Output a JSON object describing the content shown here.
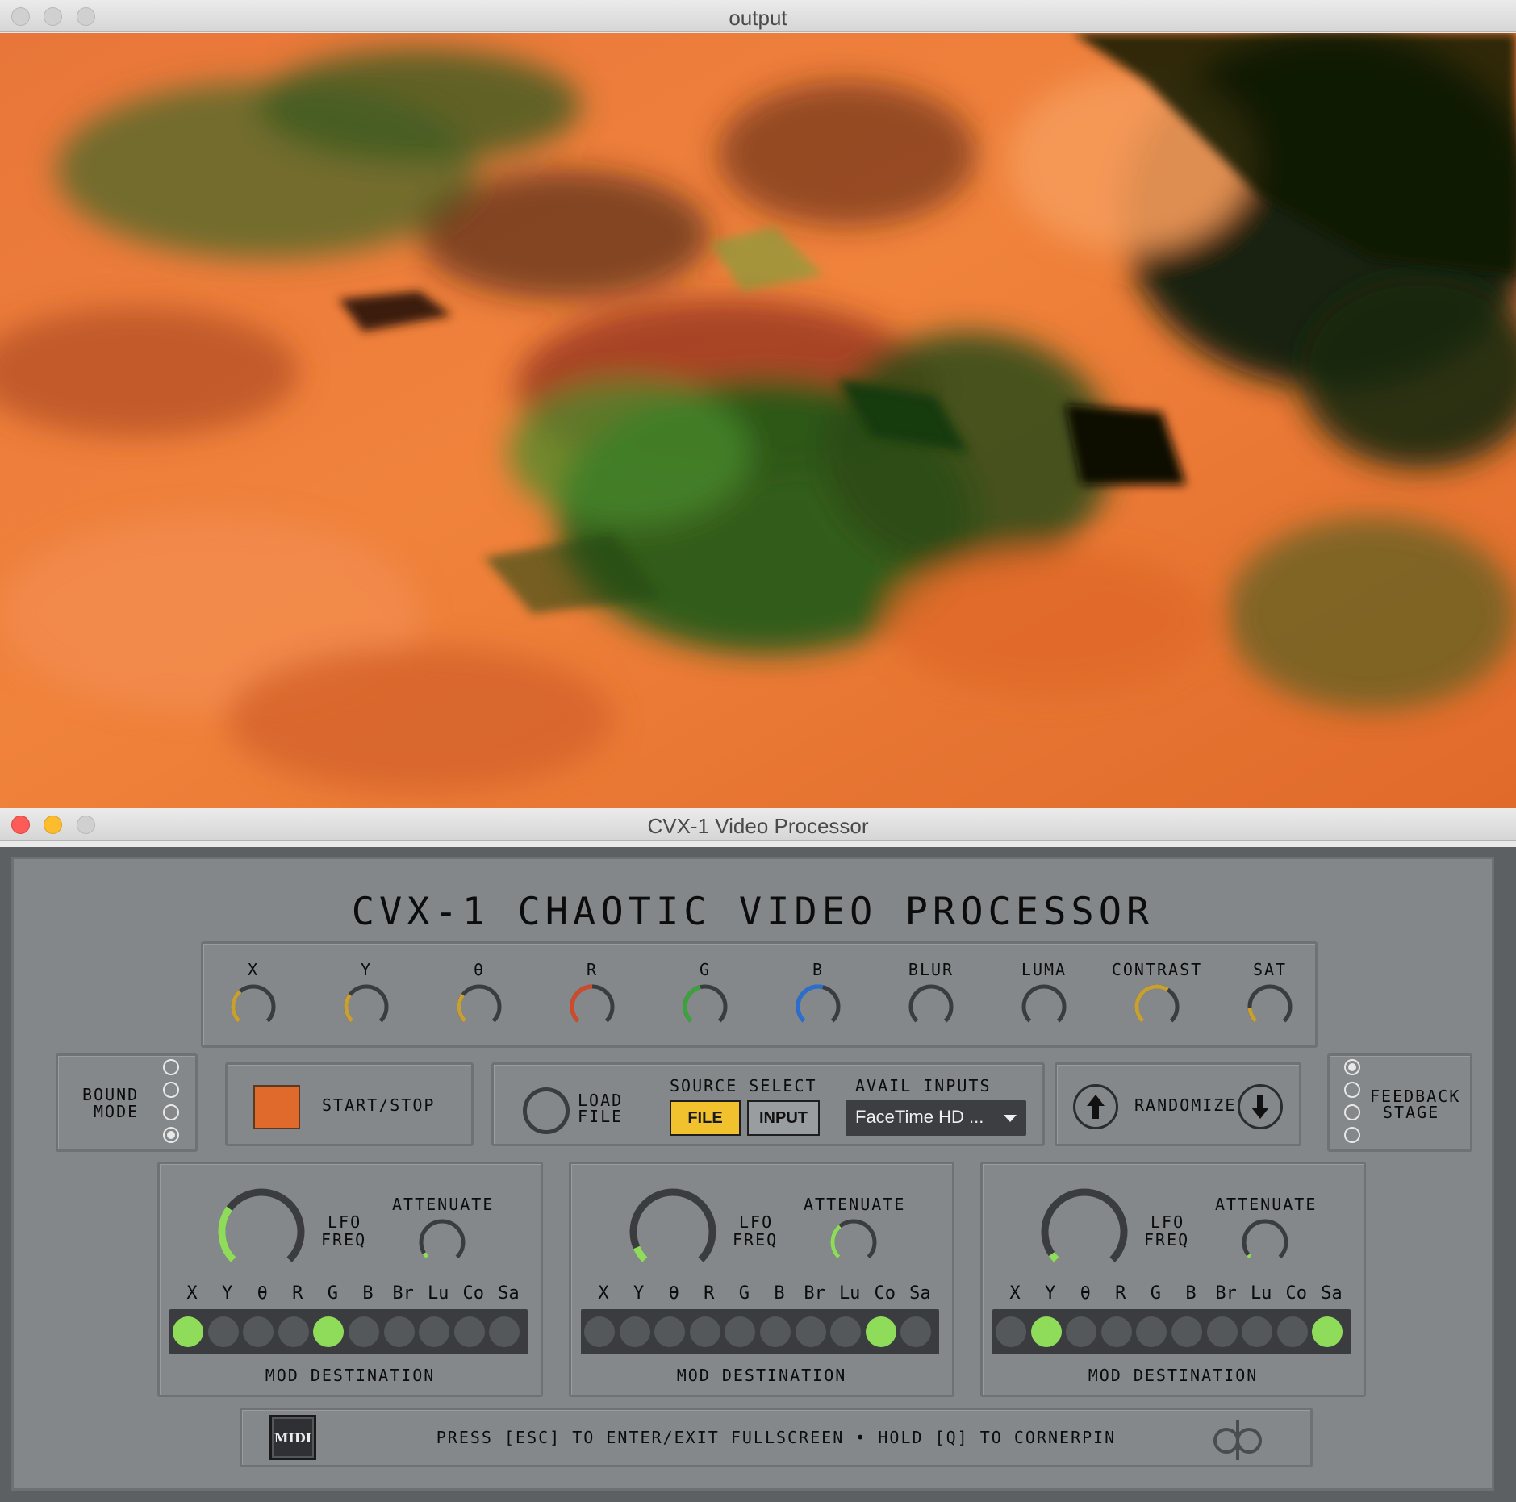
{
  "output_window": {
    "title": "output"
  },
  "processor_window": {
    "title": "CVX-1 Video Processor",
    "heading": "CVX-1 CHAOTIC VIDEO PROCESSOR"
  },
  "knobs": [
    {
      "label": "X",
      "value": 0.35,
      "color": "#c8a030"
    },
    {
      "label": "Y",
      "value": 0.3,
      "color": "#c8a030"
    },
    {
      "label": "θ",
      "value": 0.3,
      "color": "#c8a030"
    },
    {
      "label": "R",
      "value": 0.5,
      "color": "#d04a2a"
    },
    {
      "label": "G",
      "value": 0.45,
      "color": "#3aa43a"
    },
    {
      "label": "B",
      "value": 0.55,
      "color": "#2a6fd0"
    },
    {
      "label": "BLUR",
      "value": 0,
      "color": "#c8a030"
    },
    {
      "label": "LUMA",
      "value": 0,
      "color": "#c8a030"
    },
    {
      "label": "CONTRAST",
      "value": 0.62,
      "color": "#c8a030"
    },
    {
      "label": "SAT",
      "value": 0.15,
      "color": "#c8a030"
    }
  ],
  "bound_mode": {
    "label_line1": "BOUND",
    "label_line2": "MODE",
    "options": 4,
    "selected": 3
  },
  "start_stop": {
    "label": "START/STOP",
    "color": "#e06a2c"
  },
  "load_file": {
    "label_line1": "LOAD",
    "label_line2": "FILE"
  },
  "source_select": {
    "label": "SOURCE SELECT",
    "file_label": "FILE",
    "input_label": "INPUT",
    "selected": "FILE",
    "active_color": "#f2c22e"
  },
  "avail_inputs": {
    "label": "AVAIL INPUTS",
    "selected": "FaceTime HD ..."
  },
  "randomize": {
    "label": "RANDOMIZE"
  },
  "feedback_stage": {
    "label_line1": "FEEDBACK",
    "label_line2": "STAGE",
    "options": 4,
    "selected": 0
  },
  "lfo_panels": [
    {
      "freq_label_1": "LFO",
      "freq_label_2": "FREQ",
      "attenuate_label": "ATTENUATE",
      "freq_value": 0.3,
      "attenuate_value": 0.05,
      "mod_labels": [
        "X",
        "Y",
        "θ",
        "R",
        "G",
        "B",
        "Br",
        "Lu",
        "Co",
        "Sa"
      ],
      "mod_active": [
        true,
        false,
        false,
        false,
        true,
        false,
        false,
        false,
        false,
        false
      ],
      "mod_destination_label": "MOD DESTINATION"
    },
    {
      "freq_label_1": "LFO",
      "freq_label_2": "FREQ",
      "attenuate_label": "ATTENUATE",
      "freq_value": 0.08,
      "attenuate_value": 0.35,
      "mod_labels": [
        "X",
        "Y",
        "θ",
        "R",
        "G",
        "B",
        "Br",
        "Lu",
        "Co",
        "Sa"
      ],
      "mod_active": [
        false,
        false,
        false,
        false,
        false,
        false,
        false,
        false,
        true,
        false
      ],
      "mod_destination_label": "MOD DESTINATION"
    },
    {
      "freq_label_1": "LFO",
      "freq_label_2": "FREQ",
      "attenuate_label": "ATTENUATE",
      "freq_value": 0.04,
      "attenuate_value": 0.03,
      "mod_labels": [
        "X",
        "Y",
        "θ",
        "R",
        "G",
        "B",
        "Br",
        "Lu",
        "Co",
        "Sa"
      ],
      "mod_active": [
        false,
        true,
        false,
        false,
        false,
        false,
        false,
        false,
        false,
        true
      ],
      "mod_destination_label": "MOD DESTINATION"
    }
  ],
  "footer": {
    "midi_label": "MIDI",
    "hint": "PRESS [ESC] TO ENTER/EXIT FULLSCREEN • HOLD [Q] TO CORNERPIN",
    "logo_text": "dp"
  },
  "colors": {
    "led_on": "#8fdc5a",
    "lfo_arc": "#8fdc5a",
    "panel_bg": "#84878a"
  }
}
